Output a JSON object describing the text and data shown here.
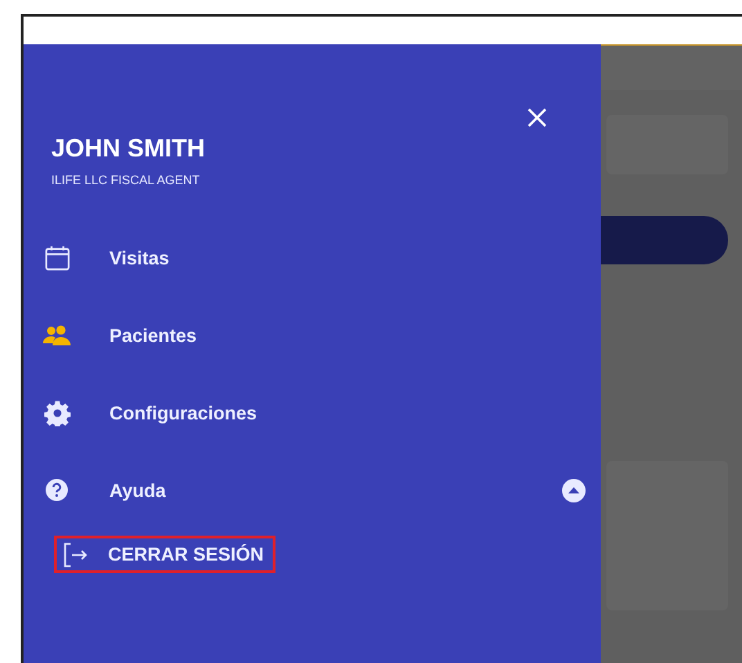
{
  "drawer": {
    "user": {
      "name": "JOHN SMITH",
      "subtitle": "ILIFE LLC FISCAL AGENT"
    },
    "items": [
      {
        "kind": "calendar",
        "label": "Visitas",
        "selected": false
      },
      {
        "kind": "people",
        "label": "Pacientes",
        "selected": true
      },
      {
        "kind": "gear",
        "label": "Configuraciones",
        "selected": false
      },
      {
        "kind": "help",
        "label": "Ayuda",
        "selected": false,
        "expanded": true,
        "children": [
          {
            "kind": "logout",
            "label": "CERRAR SESIÓN",
            "highlighted": true
          }
        ]
      }
    ]
  }
}
